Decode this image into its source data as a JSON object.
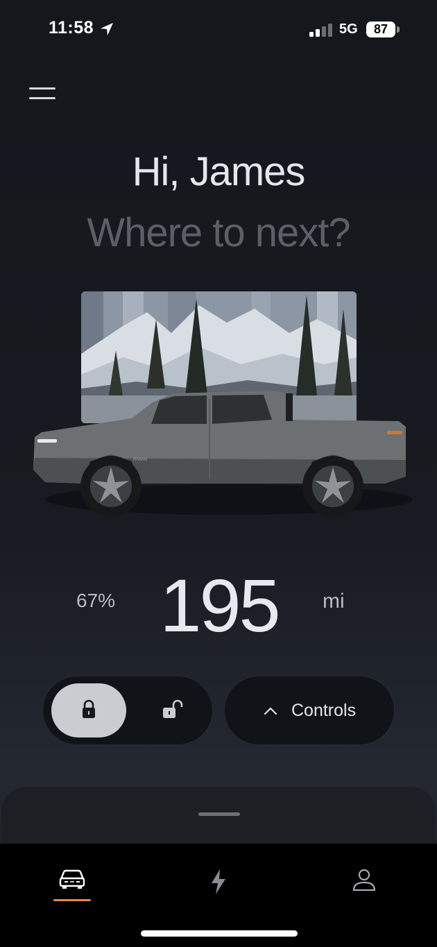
{
  "status_bar": {
    "time": "11:58",
    "network": "5G",
    "battery": "87"
  },
  "header": {
    "greeting": "Hi, James",
    "tagline": "Where to next?"
  },
  "vehicle": {
    "image": "pickup-truck-on-mountain-backdrop",
    "badge_text": "RIVIAN",
    "battery_percent": "67%",
    "range": "195",
    "range_unit": "mi"
  },
  "actions": {
    "lock_icon": "lock-closed-icon",
    "unlock_icon": "lock-open-icon",
    "controls_label": "Controls"
  },
  "tabs": [
    {
      "icon": "car-icon",
      "active": true
    },
    {
      "icon": "bolt-icon",
      "active": false
    },
    {
      "icon": "person-icon",
      "active": false
    }
  ],
  "colors": {
    "accent": "#e8894a",
    "background": "#14171c",
    "lock_active": "#c9ccd1"
  }
}
